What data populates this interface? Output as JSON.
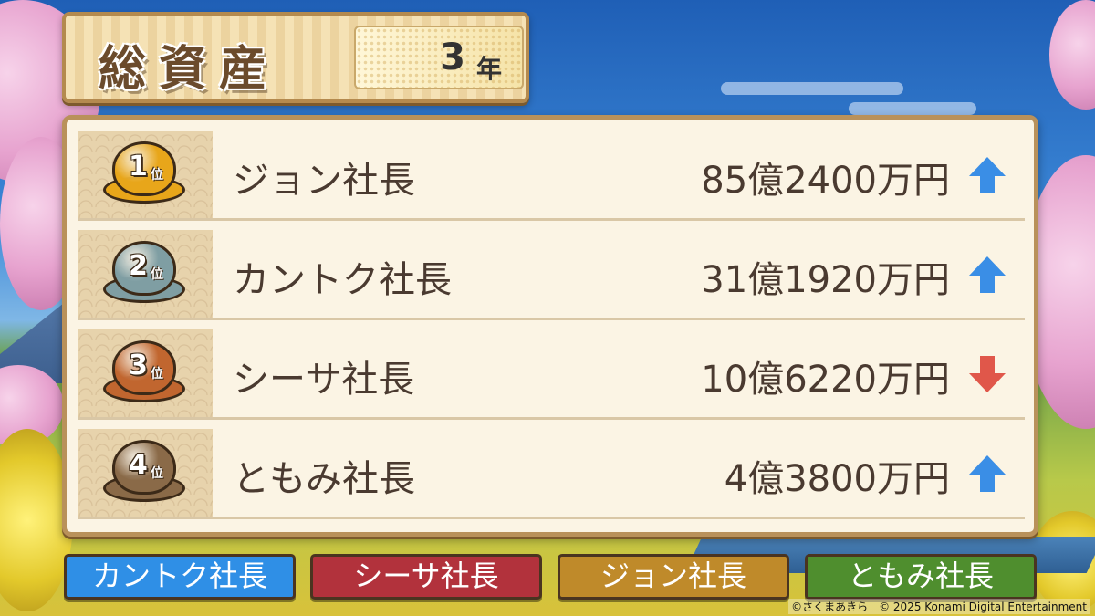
{
  "title": {
    "label": "総資産",
    "year_number": "3",
    "year_unit": "年"
  },
  "rankings": [
    {
      "rank_num": "1",
      "rank_suffix": "位",
      "name": "ジョン社長",
      "amount": "85億2400万円",
      "trend": "up",
      "medal_color": "#e8a61a"
    },
    {
      "rank_num": "2",
      "rank_suffix": "位",
      "name": "カントク社長",
      "amount": "31億1920万円",
      "trend": "up",
      "medal_color": "#7f9ea3"
    },
    {
      "rank_num": "3",
      "rank_suffix": "位",
      "name": "シーサ社長",
      "amount": "10億6220万円",
      "trend": "down",
      "medal_color": "#c1662f"
    },
    {
      "rank_num": "4",
      "rank_suffix": "位",
      "name": "ともみ社長",
      "amount": "4億3800万円",
      "trend": "up",
      "medal_color": "#8a6a48"
    }
  ],
  "trend_colors": {
    "up": "#3a8ee6",
    "down": "#e0574a"
  },
  "players": [
    {
      "label": "カントク社長",
      "color": "#2f8fe6"
    },
    {
      "label": "シーサ社長",
      "color": "#b2323c"
    },
    {
      "label": "ジョン社長",
      "color": "#bf8a2a"
    },
    {
      "label": "ともみ社長",
      "color": "#4f8e2e"
    }
  ],
  "copyright": "©さくまあきら　© 2025 Konami Digital Entertainment"
}
